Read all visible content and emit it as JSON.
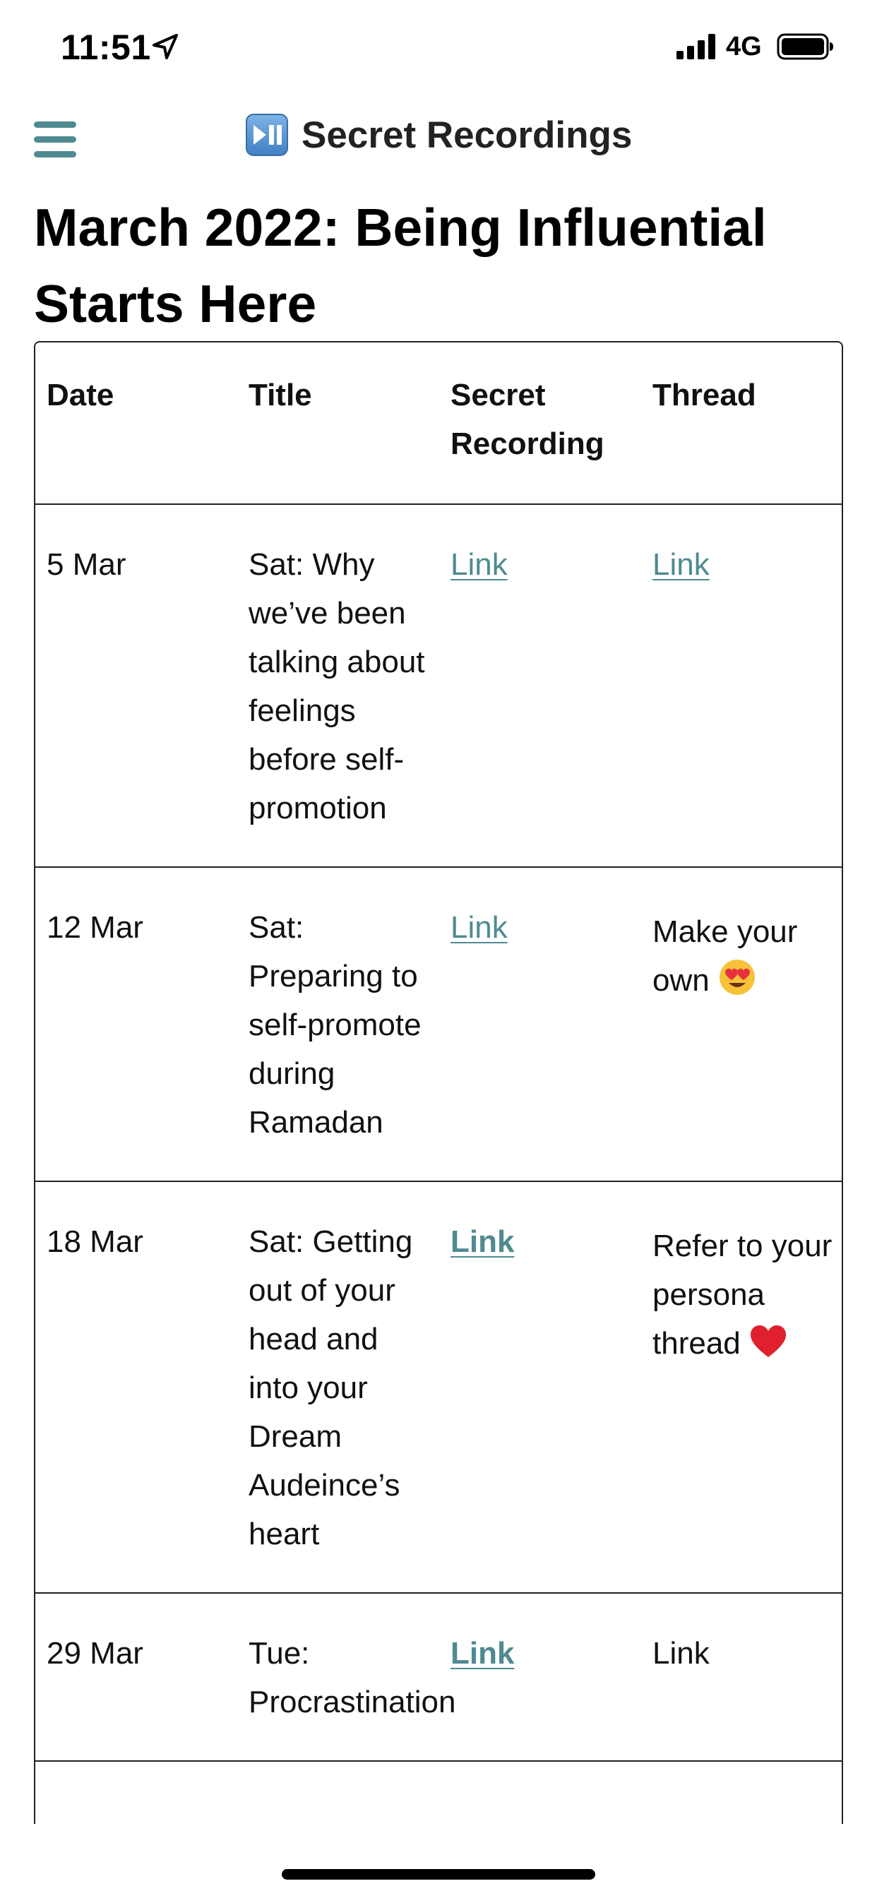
{
  "status_bar": {
    "time": "11:51",
    "network": "4G",
    "icons": [
      "location-arrow-icon",
      "cellular-signal-icon",
      "battery-icon"
    ]
  },
  "header": {
    "title": "Secret Recordings",
    "icons": [
      "menu-icon",
      "play-pause-icon"
    ],
    "accent_color": "#4f8a90"
  },
  "page": {
    "title": "March 2022: Being Influential Starts Here"
  },
  "table": {
    "columns": [
      "Date",
      "Title",
      "Secret Recording",
      "Thread"
    ],
    "rows": [
      {
        "date": "5 Mar",
        "title": "Sat: Why we’ve been talking about feelings before self-promotion",
        "recording": "Link",
        "thread": "Link"
      },
      {
        "date": "12 Mar",
        "title": "Sat: Preparing to self-promote during Ramadan",
        "recording": "Link",
        "thread": "Make your own",
        "thread_icon": "heart-eyes-emoji-icon"
      },
      {
        "date": "18 Mar",
        "title": "Sat: Getting out of your head and into your Dream Audeince’s heart",
        "recording": "Link",
        "thread": "Refer to your persona thread",
        "thread_icon": "red-heart-emoji-icon"
      },
      {
        "date": "29 Mar",
        "title": "Tue: Procrastination",
        "recording": "Link",
        "thread": "Link"
      }
    ]
  }
}
